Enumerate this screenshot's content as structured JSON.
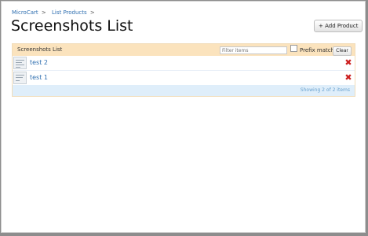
{
  "breadcrumb": {
    "items": [
      "MicroCart",
      "List Products"
    ],
    "separator": ">"
  },
  "header": {
    "title": "Screenshots List",
    "add_label": "+ Add Product"
  },
  "panel": {
    "title": "Screenshots List",
    "filter_placeholder": "Filter items",
    "prefix_label": "Prefix match",
    "clear_label": "Clear",
    "rows": [
      {
        "name": "test 2"
      },
      {
        "name": "test 1"
      }
    ],
    "footer": "Showing 2 of 2 items"
  },
  "colors": {
    "link": "#2f6fb0",
    "panel_header_bg": "#fbe3bd",
    "delete": "#cc1f1f",
    "footer_bg": "#dfeefa"
  }
}
